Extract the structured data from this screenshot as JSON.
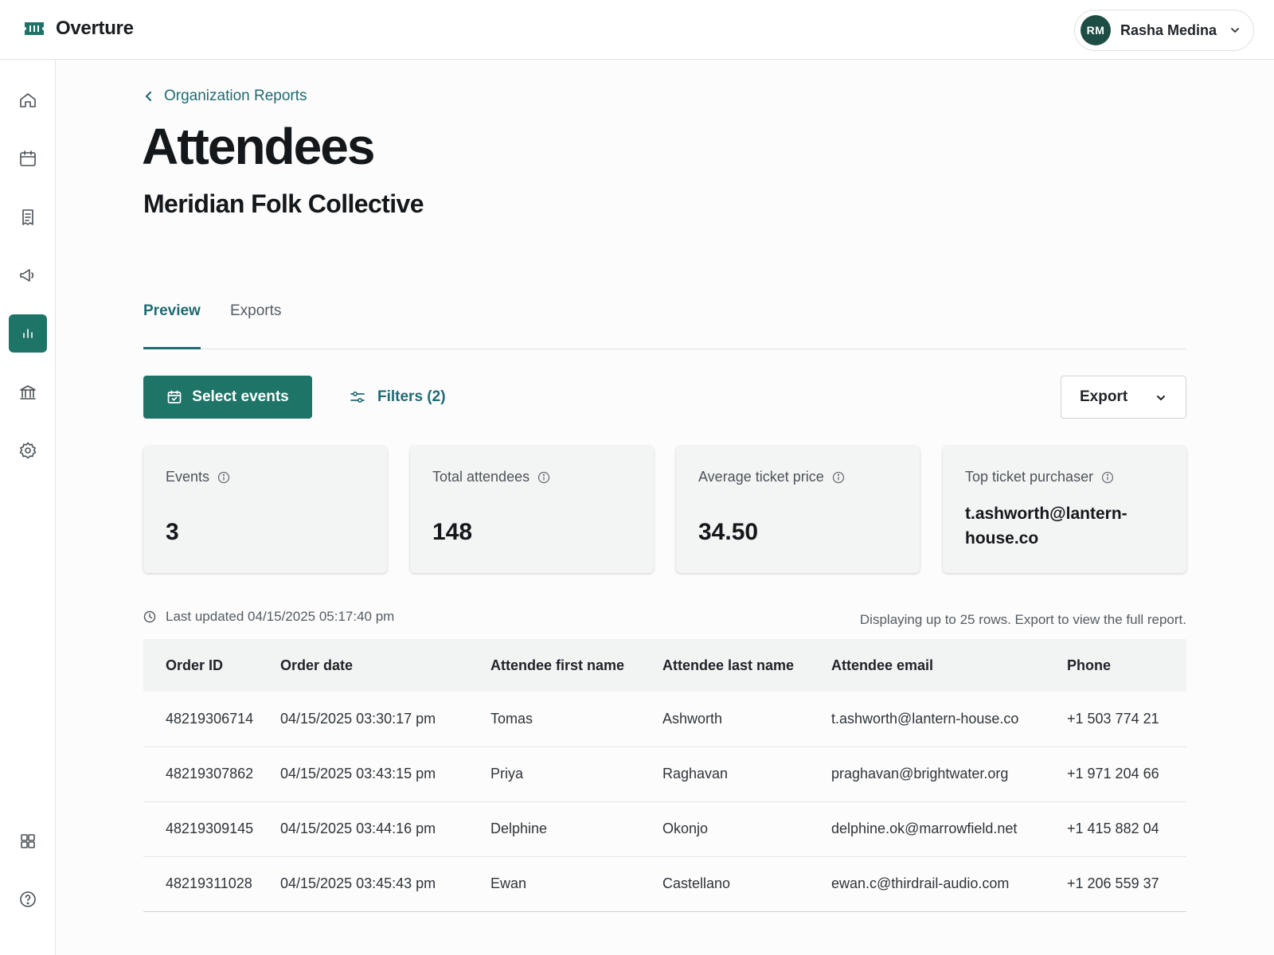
{
  "app": {
    "name": "Overture",
    "user": {
      "initials": "RM",
      "name": "Rasha Medina"
    }
  },
  "colors": {
    "accent": "#1f7468",
    "link": "#1f6b72",
    "avatar": "#1d4d44"
  },
  "sidebar": {
    "items": [
      {
        "icon": "home-icon",
        "active": false
      },
      {
        "icon": "calendar-icon",
        "active": false
      },
      {
        "icon": "receipt-icon",
        "active": false
      },
      {
        "icon": "megaphone-icon",
        "active": false
      },
      {
        "icon": "bar-chart-icon",
        "active": true
      },
      {
        "icon": "bank-icon",
        "active": false
      },
      {
        "icon": "gear-icon",
        "active": false
      },
      {
        "icon": "grid-icon",
        "active": false
      },
      {
        "icon": "help-icon",
        "active": false
      }
    ]
  },
  "page": {
    "breadcrumb": "Organization Reports",
    "title": "Attendees",
    "org_name": "Meridian Folk Collective",
    "tabs": [
      {
        "label": "Preview",
        "active": true
      },
      {
        "label": "Exports",
        "active": false
      }
    ]
  },
  "toolbar": {
    "select_events": "Select events",
    "filters": "Filters (2)",
    "export": "Export"
  },
  "stats": [
    {
      "label": "Events",
      "value": "3"
    },
    {
      "label": "Total attendees",
      "value": "148"
    },
    {
      "label": "Average ticket price",
      "value": "34.50"
    },
    {
      "label": "Top ticket purchaser",
      "value": "t.ashworth@lantern-house.co"
    }
  ],
  "report": {
    "last_updated": "Last updated 04/15/2025 05:17:40 pm",
    "displaying_note": "Displaying up to 25 rows. Export to view the full report."
  },
  "table": {
    "columns": [
      "Order ID",
      "Order date",
      "Attendee first name",
      "Attendee last name",
      "Attendee email",
      "Phone"
    ],
    "rows": [
      [
        "48219306714",
        "04/15/2025 03:30:17 pm",
        "Tomas",
        "Ashworth",
        "t.ashworth@lantern-house.co",
        "+1 503 774 21"
      ],
      [
        "48219307862",
        "04/15/2025 03:43:15 pm",
        "Priya",
        "Raghavan",
        "praghavan@brightwater.org",
        "+1 971 204 66"
      ],
      [
        "48219309145",
        "04/15/2025 03:44:16 pm",
        "Delphine",
        "Okonjo",
        "delphine.ok@marrowfield.net",
        "+1 415 882 04"
      ],
      [
        "48219311028",
        "04/15/2025 03:45:43 pm",
        "Ewan",
        "Castellano",
        "ewan.c@thirdrail-audio.com",
        "+1 206 559 37"
      ]
    ]
  }
}
